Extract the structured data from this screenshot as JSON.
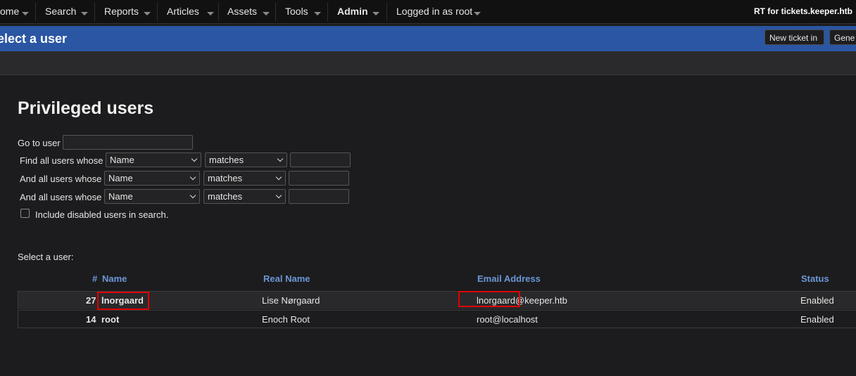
{
  "menu": {
    "items": [
      {
        "label": "ome"
      },
      {
        "label": "Search"
      },
      {
        "label": "Reports"
      },
      {
        "label": "Articles"
      },
      {
        "label": "Assets"
      },
      {
        "label": "Tools"
      },
      {
        "label": "Admin"
      },
      {
        "label": "Logged in as root"
      }
    ],
    "site_title": "RT for tickets.keeper.htb"
  },
  "header": {
    "title": "elect a user",
    "new_ticket_label": "New ticket in",
    "queue_select_value": "Gene"
  },
  "main": {
    "heading": "Privileged users",
    "go_to_user_label": "Go to user",
    "go_to_user_value": "",
    "filters": [
      {
        "label": "Find all users whose",
        "field": "Name",
        "op": "matches",
        "value": ""
      },
      {
        "label": "And all users whose",
        "field": "Name",
        "op": "matches",
        "value": ""
      },
      {
        "label": "And all users whose",
        "field": "Name",
        "op": "matches",
        "value": ""
      }
    ],
    "include_disabled_label": "Include disabled users in search.",
    "select_user_label": "Select a user:"
  },
  "table": {
    "columns": {
      "id": "#",
      "name": "Name",
      "real_name": "Real Name",
      "email": "Email Address",
      "status": "Status"
    },
    "rows": [
      {
        "id": "27",
        "name": "lnorgaard",
        "real_name": "Lise Nørgaard",
        "email": "lnorgaard@keeper.htb",
        "status": "Enabled"
      },
      {
        "id": "14",
        "name": "root",
        "real_name": "Enoch Root",
        "email": "root@localhost",
        "status": "Enabled"
      }
    ]
  },
  "colors": {
    "header_blue": "#2a56a3",
    "column_header": "#6b97d6",
    "annotation_red": "#e00000",
    "background": "#1c1c1e"
  }
}
